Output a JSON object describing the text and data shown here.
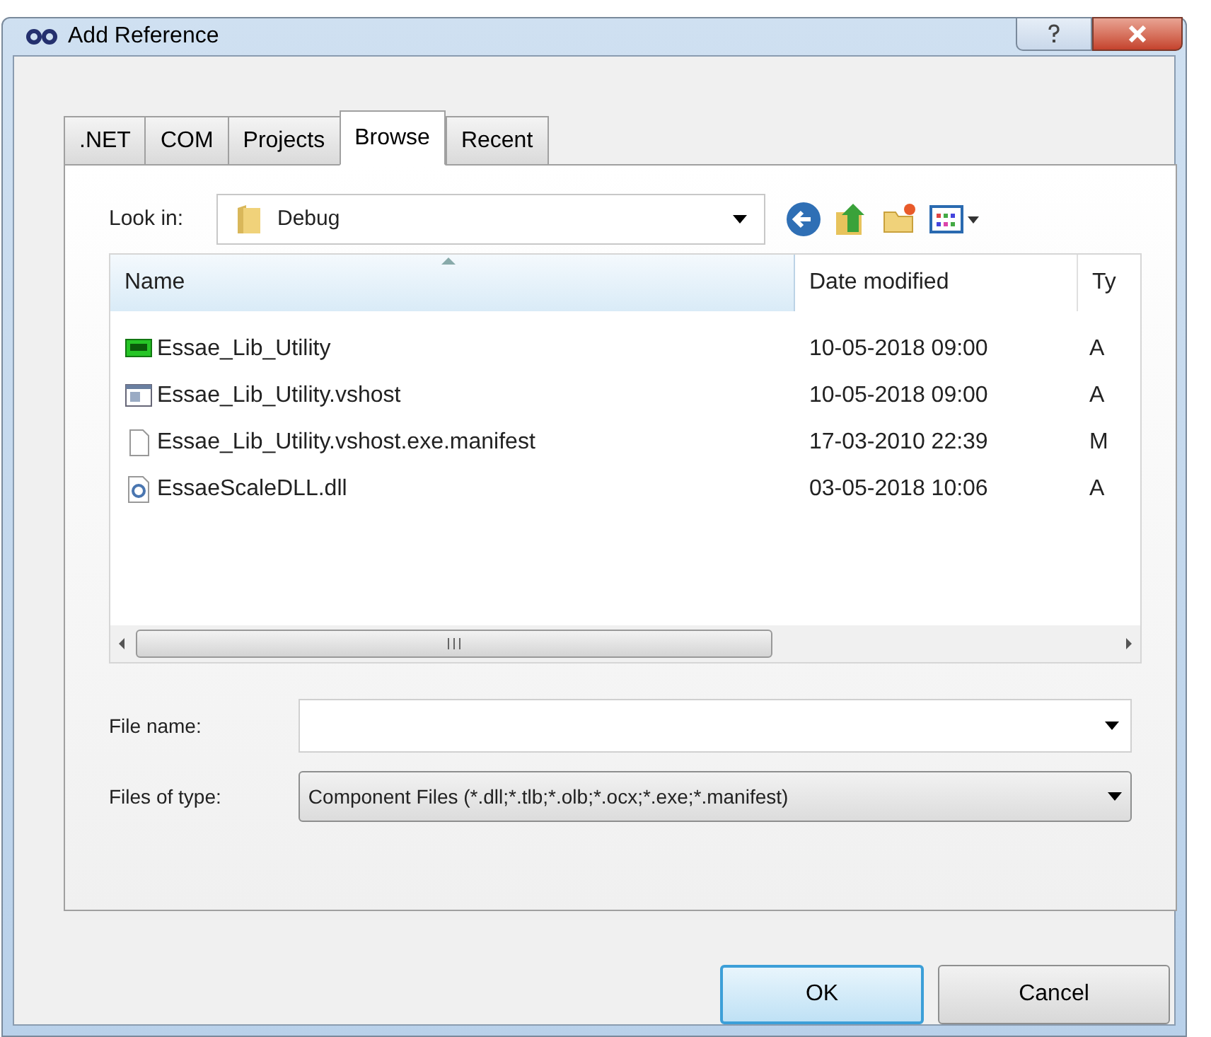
{
  "window": {
    "title": "Add Reference"
  },
  "tabs": [
    {
      "label": ".NET",
      "selected": false
    },
    {
      "label": "COM",
      "selected": false
    },
    {
      "label": "Projects",
      "selected": false
    },
    {
      "label": "Browse",
      "selected": true
    },
    {
      "label": "Recent",
      "selected": false
    }
  ],
  "look_in": {
    "label": "Look in:",
    "value": "Debug"
  },
  "file_list": {
    "columns": [
      "Name",
      "Date modified",
      "Ty"
    ],
    "rows": [
      {
        "kind": "app",
        "name": "Essae_Lib_Utility",
        "date": "10-05-2018 09:00",
        "column_3": "A"
      },
      {
        "kind": "window",
        "name": "Essae_Lib_Utility.vshost",
        "date": "10-05-2018 09:00",
        "column_3": "A"
      },
      {
        "kind": "file",
        "name": "Essae_Lib_Utility.vshost.exe.manifest",
        "date": "17-03-2010 22:39",
        "column_3": "M"
      },
      {
        "kind": "dll",
        "name": "EssaeScaleDLL.dll",
        "date": "03-05-2018 10:06",
        "column_3": "A"
      }
    ]
  },
  "file_name": {
    "label": "File name:"
  },
  "file_type": {
    "label": "Files of type:",
    "value": "Component Files (*.dll;*.tlb;*.olb;*.ocx;*.exe;*.manifest)"
  },
  "buttons": [
    {
      "label": "OK",
      "kind": "default"
    },
    {
      "label": "Cancel",
      "kind": "normal"
    }
  ]
}
